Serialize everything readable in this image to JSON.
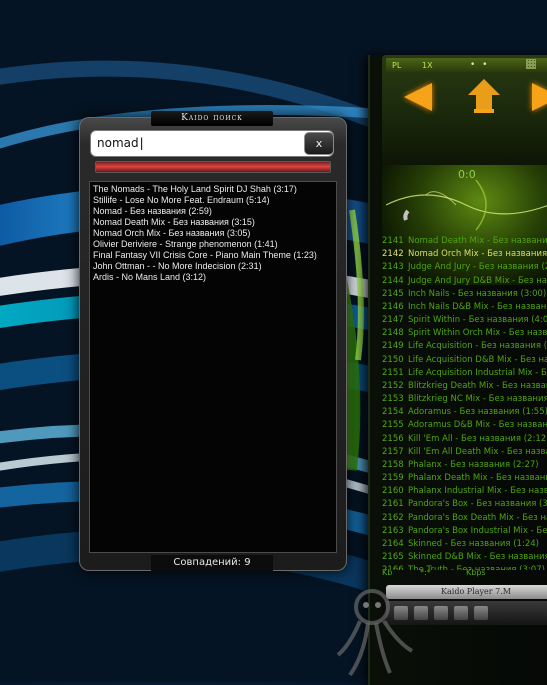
{
  "search_window": {
    "title": "Kaido поиск",
    "query": "nomad",
    "clear_label": "x",
    "progress": 1.0,
    "results": [
      "The Nomads - The Holy Land Spirit DJ Shah (3:17)",
      "Stillife - Lose No More Feat. Endraum (5:14)",
      "Nomad - Без названия (2:59)",
      "Nomad Death Mix - Без названия (3:15)",
      "Nomad Orch Mix - Без названия (3:05)",
      "Olivier Deriviere - Strange phenomenon (1:41)",
      "Final Fantasy VII Crisis Core - Piano Main Theme (1:23)",
      "John Ottman - - No More Indecision (2:31)",
      "Ardis - No Mans Land (3:12)"
    ],
    "status": "Совпадений: 9"
  },
  "player": {
    "buttons": {
      "pl": "PL",
      "x": "1X",
      "dots": "• •"
    },
    "time": "0:0",
    "current_index": 1,
    "playlist": [
      {
        "num": "2141",
        "title": "Nomad Death Mix - Без названия (3"
      },
      {
        "num": "2142",
        "title": "Nomad Orch Mix - Без названия (3"
      },
      {
        "num": "2143",
        "title": "Judge And Jury - Без названия (2:4"
      },
      {
        "num": "2144",
        "title": "Judge And Jury D&B Mix - Без назв"
      },
      {
        "num": "2145",
        "title": "Inch Nails - Без названия (3:00)"
      },
      {
        "num": "2146",
        "title": "Inch Nails D&B Mix - Без названия"
      },
      {
        "num": "2147",
        "title": "Spirit Within - Без названия (4:08)"
      },
      {
        "num": "2148",
        "title": "Spirit Within Orch Mix - Без назва"
      },
      {
        "num": "2149",
        "title": "Life Acquisition - Без названия (3:5"
      },
      {
        "num": "2150",
        "title": "Life Acquisition D&B Mix - Без назв"
      },
      {
        "num": "2151",
        "title": "Life Acquisition Industrial Mix - Без"
      },
      {
        "num": "2152",
        "title": "Blitzkrieg Death Mix - Без названия"
      },
      {
        "num": "2153",
        "title": "Blitzkrieg NC Mix - Без названия (3"
      },
      {
        "num": "2154",
        "title": "Adoramus - Без названия (1:55)"
      },
      {
        "num": "2155",
        "title": "Adoramus D&B Mix - Без названия"
      },
      {
        "num": "2156",
        "title": "Kill 'Em All - Без названия (2:12)"
      },
      {
        "num": "2157",
        "title": "Kill 'Em All Death Mix - Без назван"
      },
      {
        "num": "2158",
        "title": "Phalanx - Без названия (2:27)"
      },
      {
        "num": "2159",
        "title": "Phalanx Death Mix - Без названия"
      },
      {
        "num": "2160",
        "title": "Phalanx Industrial Mix - Без назва"
      },
      {
        "num": "2161",
        "title": "Pandora's Box - Без названия (3:35"
      },
      {
        "num": "2162",
        "title": "Pandora's Box Death Mix - Без назв"
      },
      {
        "num": "2163",
        "title": "Pandora's Box Industrial Mix - Без"
      },
      {
        "num": "2164",
        "title": "Skinned - Без названия (1:24)"
      },
      {
        "num": "2165",
        "title": "Skinned D&B Mix - Без названия"
      },
      {
        "num": "2166",
        "title": "The Truth - Без названия (3:07)"
      }
    ],
    "footer": {
      "kb": "Kb",
      "mid": "*:*",
      "kbps": "Kbps"
    },
    "brand": "Kaido Player 7.M"
  },
  "colors": {
    "playlist_text": "#4fa312",
    "playlist_current": "#d7df6b",
    "accent_orange": "#f6a31a",
    "progress_red": "#e04444"
  }
}
